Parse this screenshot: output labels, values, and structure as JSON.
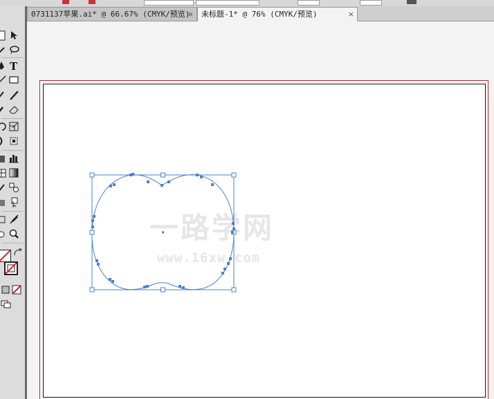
{
  "tabs": [
    {
      "label": "0731137苹果.ai* @ 66.67% (CMYK/预览)",
      "close": "×"
    },
    {
      "label": "未标题-1* @ 76% (CMYK/预览)",
      "close": "×"
    }
  ],
  "active_tab": 1,
  "watermark": {
    "line1": "一路学网",
    "line2": "www.16xw.com"
  },
  "tools": [
    "selection-tool",
    "direct-selection-tool",
    "magic-wand-tool",
    "lasso-tool",
    "pen-tool",
    "type-tool",
    "line-segment-tool",
    "rectangle-tool",
    "paintbrush-tool",
    "pencil-tool",
    "blob-brush-tool",
    "eraser-tool",
    "rotate-tool",
    "scale-tool",
    "warp-tool",
    "free-transform-tool",
    "symbol-sprayer-tool",
    "column-graph-tool",
    "mesh-tool",
    "gradient-tool",
    "eyedropper-tool",
    "blend-tool",
    "live-paint-bucket-tool",
    "live-paint-selection-tool",
    "artboard-tool",
    "slice-tool",
    "hand-tool",
    "zoom-tool"
  ],
  "colors": {
    "selection": "#4a7fd6",
    "bleed_guide": "#c1202c",
    "artboard_border": "#111111"
  }
}
